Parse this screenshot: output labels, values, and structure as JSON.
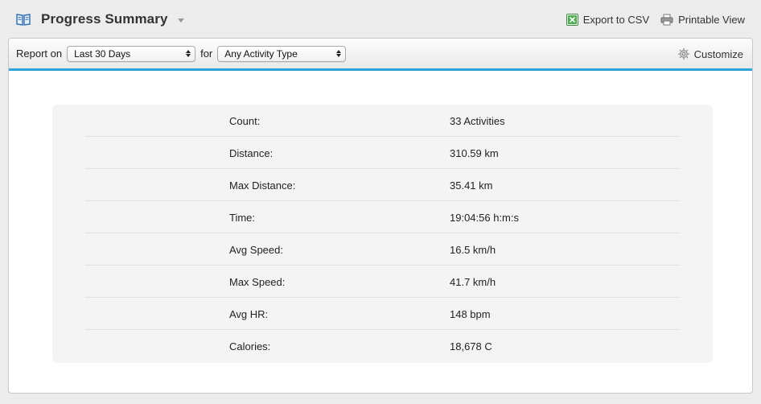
{
  "header": {
    "title": "Progress Summary",
    "icons": {
      "title": "book-icon",
      "csv": "excel-icon",
      "print": "printer-icon",
      "menu": "caret-down-icon"
    },
    "actions": {
      "export_label": "Export to CSV",
      "print_label": "Printable View"
    }
  },
  "toolbar": {
    "report_on_label": "Report on",
    "period_value": "Last 30 Days",
    "for_label": "for",
    "activity_value": "Any Activity Type",
    "customize_label": "Customize",
    "customize_icon": "gear-icon",
    "accent_color": "#2ea3d8"
  },
  "summary": {
    "rows": [
      {
        "label": "Count:",
        "value": "33 Activities"
      },
      {
        "label": "Distance:",
        "value": "310.59 km"
      },
      {
        "label": "Max Distance:",
        "value": "35.41 km"
      },
      {
        "label": "Time:",
        "value": "19:04:56 h:m:s"
      },
      {
        "label": "Avg Speed:",
        "value": "16.5 km/h"
      },
      {
        "label": "Max Speed:",
        "value": "41.7 km/h"
      },
      {
        "label": "Avg HR:",
        "value": "148 bpm"
      },
      {
        "label": "Calories:",
        "value": "18,678 C"
      }
    ]
  }
}
